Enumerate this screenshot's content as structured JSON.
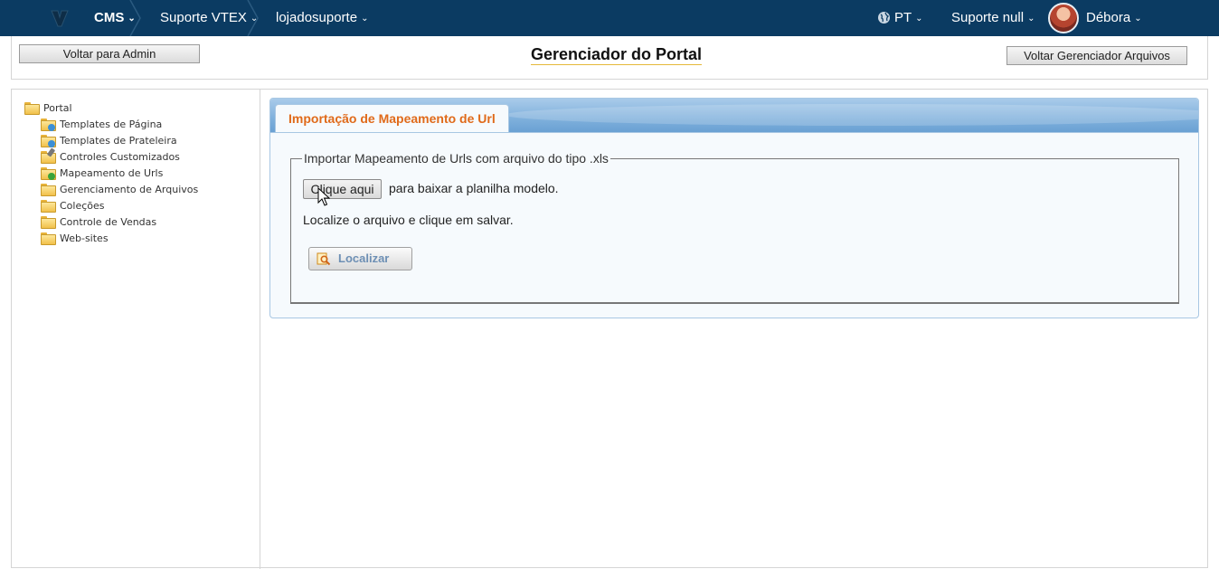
{
  "topbar": {
    "app": "CMS",
    "account": "Suporte VTEX",
    "store": "lojadosuporte",
    "language": "PT",
    "workspace": "Suporte null",
    "user": "Débora",
    "colors": {
      "background": "#0b3b62"
    }
  },
  "header": {
    "back_admin": "Voltar para Admin",
    "title": "Gerenciador do Portal",
    "back_files": "Voltar Gerenciador Arquivos"
  },
  "sidebar": {
    "root": "Portal",
    "items": [
      {
        "label": "Templates de Página",
        "icon": "folder-refresh-icon"
      },
      {
        "label": "Templates de Prateleira",
        "icon": "folder-refresh-icon"
      },
      {
        "label": "Controles Customizados",
        "icon": "folder-edit-icon"
      },
      {
        "label": "Mapeamento de Urls",
        "icon": "folder-arrow-icon"
      },
      {
        "label": "Gerenciamento de Arquivos",
        "icon": "folder-icon"
      },
      {
        "label": "Coleções",
        "icon": "folder-icon"
      },
      {
        "label": "Controle de Vendas",
        "icon": "folder-icon"
      },
      {
        "label": "Web-sites",
        "icon": "folder-icon"
      }
    ]
  },
  "content": {
    "tab": "Importação de Mapeamento de Url",
    "legend": "Importar Mapeamento de Urls com arquivo do tipo .xls",
    "download_button": "Clique aqui",
    "download_text": "para baixar a planilha modelo.",
    "instruction": "Localize o arquivo e clique em salvar.",
    "browse_button": "Localizar",
    "colors": {
      "tab_text": "#e06a1a",
      "accent_blue": "#7fb0dc"
    }
  }
}
